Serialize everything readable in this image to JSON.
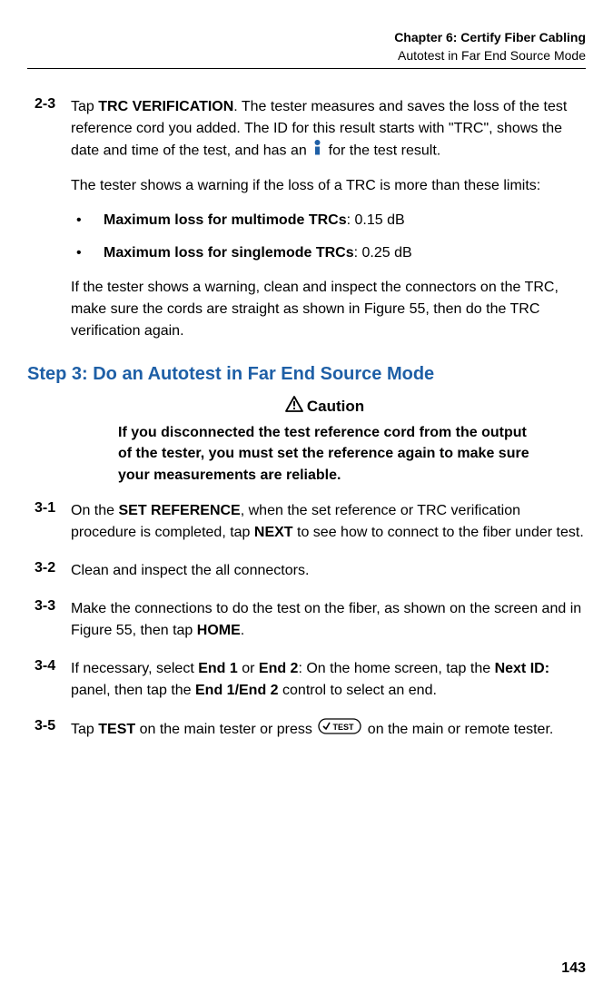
{
  "header": {
    "chapter": "Chapter 6: Certify Fiber Cabling",
    "section": "Autotest in Far End Source Mode"
  },
  "step2_3": {
    "num": "2-3",
    "p1_pre": "Tap ",
    "p1_bold": "TRC VERIFICATION",
    "p1_post": ". The tester measures and saves the loss of the test reference cord you added. The ID for this result starts with \"TRC\", shows the date and time of the test, and has an ",
    "p1_end": " for the test result.",
    "p2": "The tester shows a warning if the loss of a TRC is more than these limits:",
    "b1_bold": "Maximum loss for multimode TRCs",
    "b1_post": ": 0.15 dB",
    "b2_bold": "Maximum loss for singlemode TRCs",
    "b2_post": ": 0.25 dB",
    "p3": "If the tester shows a warning, clean and inspect the connectors on the TRC, make sure the cords are straight as shown in Figure 55, then do the TRC verification again."
  },
  "step3heading": "Step 3: Do an Autotest in Far End Source Mode",
  "caution": {
    "title": "Caution",
    "text": "If you disconnected the test reference cord from the output of the tester, you must set the reference again to make sure your measurements are reliable."
  },
  "step3_1": {
    "num": "3-1",
    "pre": "On the ",
    "bold1": "SET REFERENCE",
    "mid": ", when the set reference or TRC verification procedure is completed, tap ",
    "bold2": "NEXT",
    "post": " to see how to connect to the fiber under test."
  },
  "step3_2": {
    "num": "3-2",
    "text": "Clean and inspect the all connectors."
  },
  "step3_3": {
    "num": "3-3",
    "pre": "Make the connections to do the test on the fiber, as shown on the screen and in Figure 55, then tap ",
    "bold": "HOME",
    "post": "."
  },
  "step3_4": {
    "num": "3-4",
    "pre": "If necessary, select ",
    "b1": "End 1",
    "m1": " or ",
    "b2": "End 2",
    "m2": ": On the home screen, tap the ",
    "b3": "Next ID:",
    "m3": " panel, then tap the ",
    "b4": "End 1/End 2",
    "post": " control to select an end."
  },
  "step3_5": {
    "num": "3-5",
    "pre": "Tap ",
    "b1": "TEST",
    "mid": " on the main tester or press ",
    "post": " on the main or remote tester."
  },
  "pageNumber": "143"
}
